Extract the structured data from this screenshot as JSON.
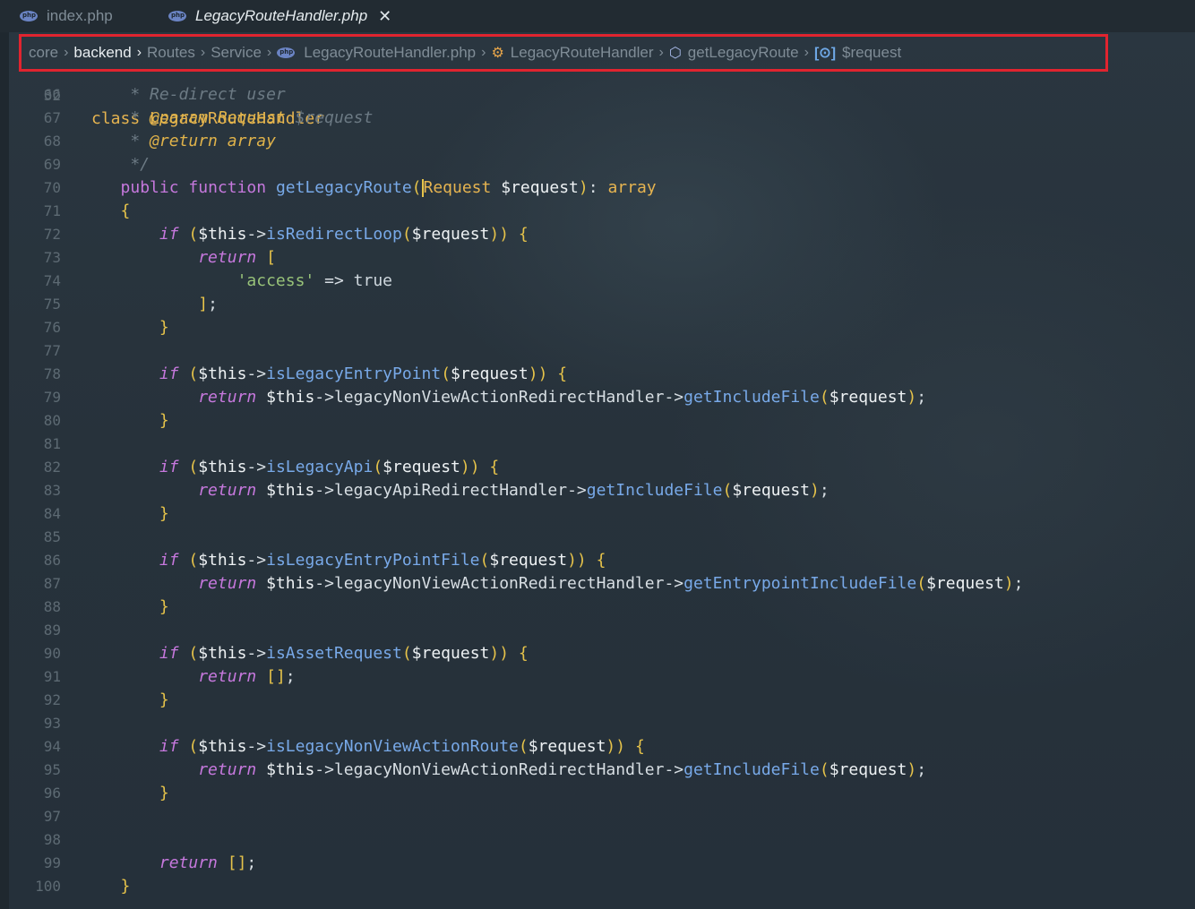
{
  "tabs": [
    {
      "label": "index.php",
      "icon": "php-icon",
      "active": false
    },
    {
      "label": "LegacyRouteHandler.php",
      "icon": "php-icon",
      "active": true,
      "close": "✕"
    }
  ],
  "breadcrumb": {
    "items": [
      "core",
      "backend",
      "Routes",
      "Service",
      "LegacyRouteHandler.php",
      "LegacyRouteHandler",
      "getLegacyRoute",
      "$request"
    ],
    "highlight_color": "#e1242f"
  },
  "editor": {
    "partial_line": {
      "number": "32",
      "text": "class LegacyRouteHandler"
    },
    "lines": [
      {
        "n": "66",
        "t": "    * Re-direct user"
      },
      {
        "n": "67",
        "t": "    * @param Request $request"
      },
      {
        "n": "68",
        "t": "    * @return array"
      },
      {
        "n": "69",
        "t": "    */"
      },
      {
        "n": "70",
        "t": "   public function getLegacyRoute(Request $request): array"
      },
      {
        "n": "71",
        "t": "   {"
      },
      {
        "n": "72",
        "t": "       if ($this->isRedirectLoop($request)) {"
      },
      {
        "n": "73",
        "t": "           return ["
      },
      {
        "n": "74",
        "t": "               'access' => true"
      },
      {
        "n": "75",
        "t": "           ];"
      },
      {
        "n": "76",
        "t": "       }"
      },
      {
        "n": "77",
        "t": ""
      },
      {
        "n": "78",
        "t": "       if ($this->isLegacyEntryPoint($request)) {"
      },
      {
        "n": "79",
        "t": "           return $this->legacyNonViewActionRedirectHandler->getIncludeFile($request);"
      },
      {
        "n": "80",
        "t": "       }"
      },
      {
        "n": "81",
        "t": ""
      },
      {
        "n": "82",
        "t": "       if ($this->isLegacyApi($request)) {"
      },
      {
        "n": "83",
        "t": "           return $this->legacyApiRedirectHandler->getIncludeFile($request);"
      },
      {
        "n": "84",
        "t": "       }"
      },
      {
        "n": "85",
        "t": ""
      },
      {
        "n": "86",
        "t": "       if ($this->isLegacyEntryPointFile($request)) {"
      },
      {
        "n": "87",
        "t": "           return $this->legacyNonViewActionRedirectHandler->getEntrypointIncludeFile($request);"
      },
      {
        "n": "88",
        "t": "       }"
      },
      {
        "n": "89",
        "t": ""
      },
      {
        "n": "90",
        "t": "       if ($this->isAssetRequest($request)) {"
      },
      {
        "n": "91",
        "t": "           return [];"
      },
      {
        "n": "92",
        "t": "       }"
      },
      {
        "n": "93",
        "t": ""
      },
      {
        "n": "94",
        "t": "       if ($this->isLegacyNonViewActionRoute($request)) {"
      },
      {
        "n": "95",
        "t": "           return $this->legacyNonViewActionRedirectHandler->getIncludeFile($request);"
      },
      {
        "n": "96",
        "t": "       }"
      },
      {
        "n": "97",
        "t": ""
      },
      {
        "n": "98",
        "t": ""
      },
      {
        "n": "99",
        "t": "       return [];"
      },
      {
        "n": "100",
        "t": "   }"
      }
    ]
  }
}
